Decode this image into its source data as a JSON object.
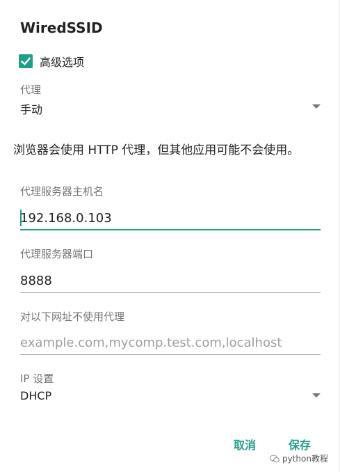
{
  "dialog": {
    "title": "WiredSSID",
    "advanced_label": "高级选项",
    "advanced_checked": true,
    "proxy": {
      "label": "代理",
      "value": "手动"
    },
    "warning": "浏览器会使用 HTTP 代理，但其他应用可能不会使用。",
    "host": {
      "label": "代理服务器主机名",
      "value": "192.168.0.103"
    },
    "port": {
      "label": "代理服务器端口",
      "value": "8888"
    },
    "bypass": {
      "label": "对以下网址不使用代理",
      "placeholder": "example.com,mycomp.test.com,localhost"
    },
    "ip": {
      "label": "IP 设置",
      "value": "DHCP"
    },
    "cancel_label": "取消",
    "save_label": "保存"
  },
  "watermark": {
    "text": "python教程"
  },
  "colors": {
    "accent": "#1f9e8a",
    "text": "#212121",
    "secondary": "#757575"
  }
}
